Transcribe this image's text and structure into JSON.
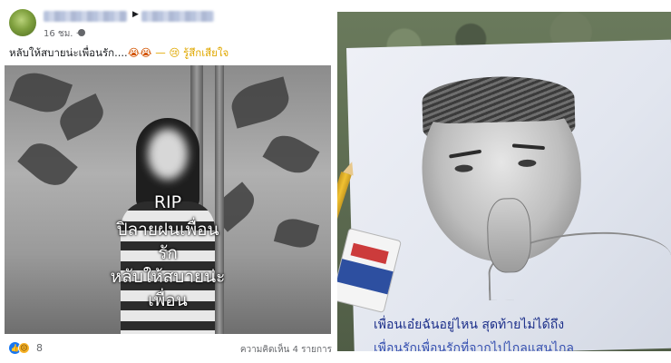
{
  "post": {
    "time": "16 ชม. ·",
    "text_main": "หลับให้สบายน่ะเพื่อนรัก....",
    "text_emoji": "😭😭",
    "text_feeling": "— 😢 รู้สึกเสียใจ",
    "photo_caption": [
      "RIP",
      "ปิลายฝนเพื่อน",
      "รัก",
      "หลับให้สบายน่ะ",
      "เพื่อน"
    ],
    "reaction_count": "8",
    "comments_label": "ความคิดเห็น 4 รายการ"
  },
  "icons": {
    "avatar": "avatar",
    "arrow": "triangle-right-icon",
    "privacy": "globe-icon",
    "like": "like-reaction-icon",
    "sad": "sad-reaction-icon"
  },
  "sketch": {
    "handwriting_1": "เพื่อนเอ๋ยฉันอยู่ไหน สุดท้ายไม่ได้ถึง",
    "handwriting_2": "เพื่อนรักเพื่อนรักที่จากไปไกลแสนไกล"
  },
  "colors": {
    "fb_blue": "#1877f2",
    "sad_yellow": "#f7b125",
    "ink_blue": "#1c2f8a"
  }
}
